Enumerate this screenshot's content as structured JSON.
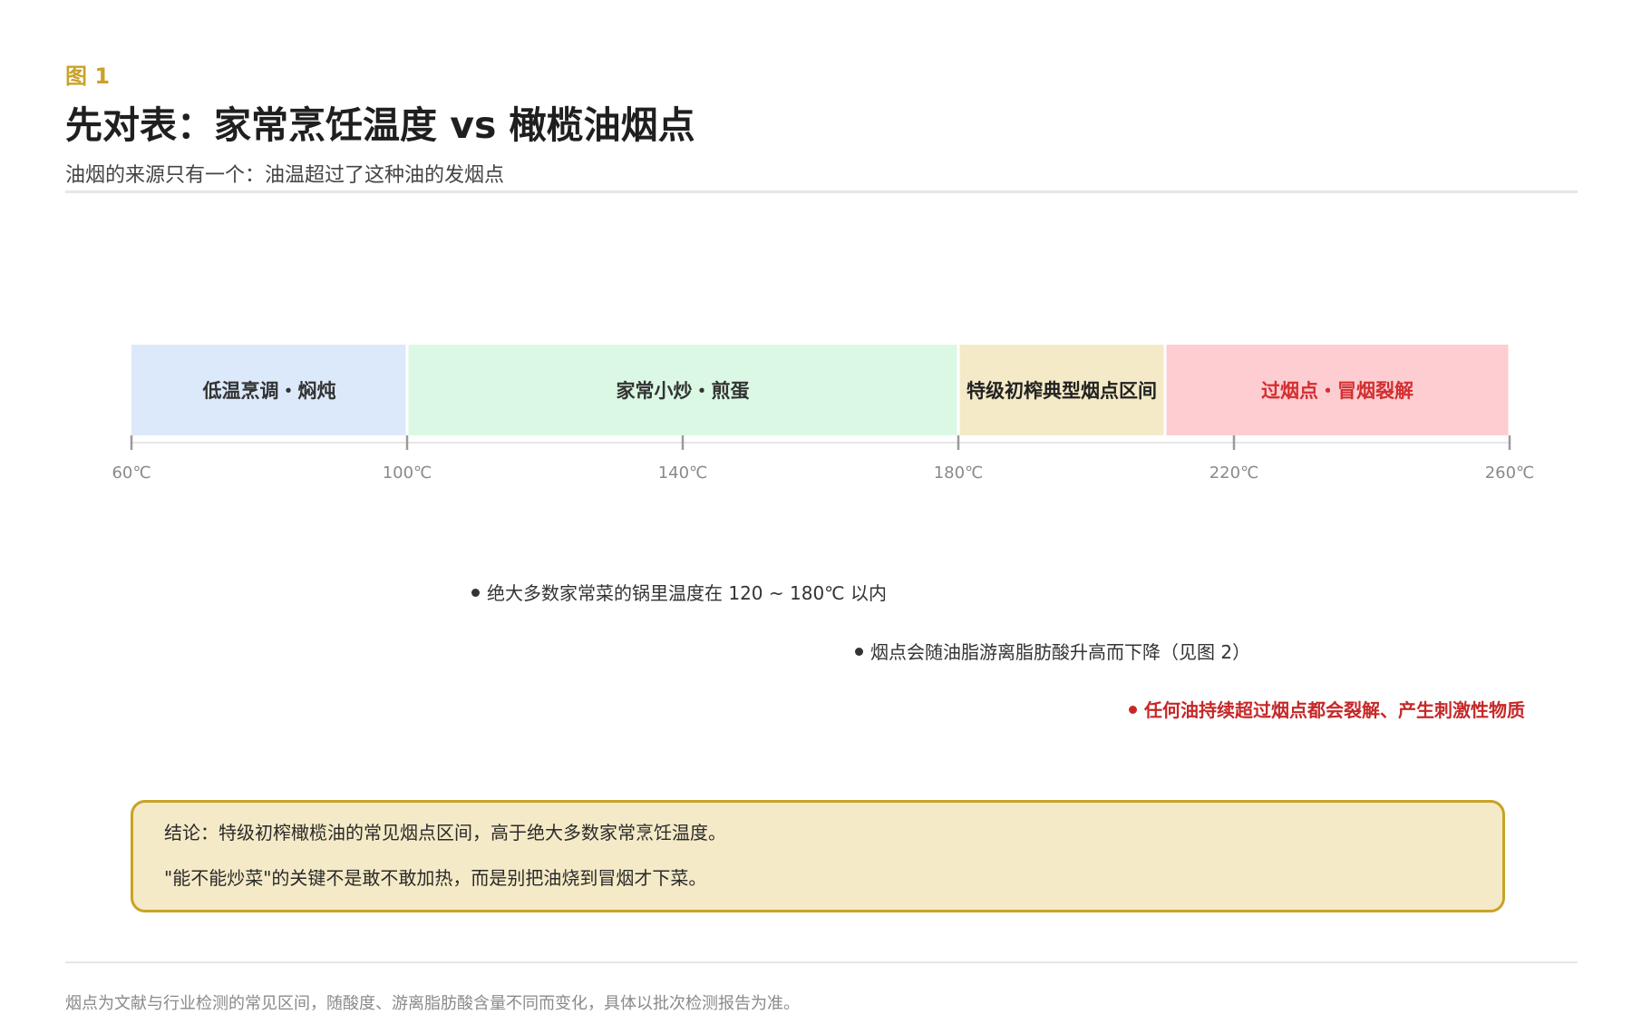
{
  "figure_label": "图 1",
  "title": "先对表：家常烹饪温度 vs 橄榄油烟点",
  "subtitle": "油烟的来源只有一个：油温超过了这种油的发烟点",
  "chart_data": {
    "type": "bar",
    "axis": {
      "min": 60,
      "max": 260,
      "ticks": [
        60,
        100,
        140,
        180,
        220,
        260
      ],
      "tick_labels": [
        "60℃",
        "100℃",
        "140℃",
        "180℃",
        "220℃",
        "260℃"
      ]
    },
    "bands": [
      {
        "label": "低温烹调・焖炖",
        "from": 60,
        "to": 100,
        "color": "#dce9fb",
        "text_color": "#333333"
      },
      {
        "label": "家常小炒・煎蛋",
        "from": 100,
        "to": 180,
        "color": "#daf8e3",
        "text_color": "#333333"
      },
      {
        "label": "特级初榨典型烟点区间",
        "from": 180,
        "to": 210,
        "color": "#f5eac7",
        "text_color": "#222222"
      },
      {
        "label": "过烟点・冒烟裂解",
        "from": 210,
        "to": 260,
        "color": "#fdcdd2",
        "text_color": "#d32f2f"
      }
    ],
    "annotations": [
      {
        "text": "绝大多数家常菜的锅里温度在 120 ~ 180℃ 以内",
        "style": "normal"
      },
      {
        "text": "烟点会随油脂游离脂肪酸升高而下降（见图 2）",
        "style": "normal"
      },
      {
        "text": "任何油持续超过烟点都会裂解、产生刺激性物质",
        "style": "warning"
      }
    ]
  },
  "conclusion": {
    "line1": "结论：特级初榨橄榄油的常见烟点区间，高于绝大多数家常烹饪温度。",
    "line2": "\"能不能炒菜\"的关键不是敢不敢加热，而是别把油烧到冒烟才下菜。"
  },
  "footnote": "烟点为文献与行业检测的常见区间，随酸度、游离脂肪酸含量不同而变化，具体以批次检测报告为准。",
  "colors": {
    "accent": "#c9a227",
    "warning": "#c62828",
    "axis": "#9a9a9a"
  }
}
